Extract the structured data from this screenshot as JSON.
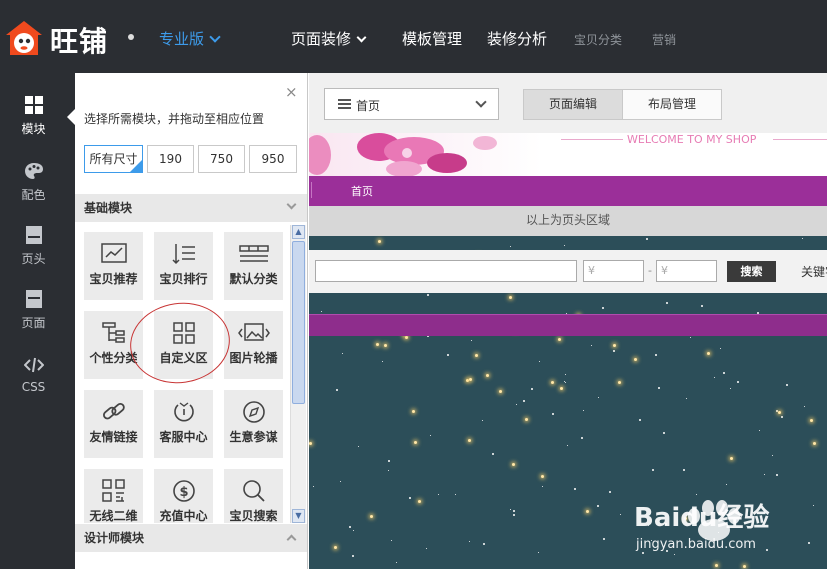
{
  "header": {
    "brand": "旺铺",
    "edition": "专业版",
    "nav": [
      {
        "label": "页面装修"
      },
      {
        "label": "模板管理"
      },
      {
        "label": "装修分析"
      },
      {
        "label": "宝贝分类"
      },
      {
        "label": "营销"
      }
    ]
  },
  "rail": {
    "items": [
      {
        "label": "模块",
        "icon": "grid-icon"
      },
      {
        "label": "配色",
        "icon": "palette-icon"
      },
      {
        "label": "页头",
        "icon": "page-header-icon"
      },
      {
        "label": "页面",
        "icon": "page-icon"
      },
      {
        "label": "CSS",
        "icon": "code-icon"
      }
    ]
  },
  "panel": {
    "close": "×",
    "tip": "选择所需模块，并拖动至相应位置",
    "sizes": [
      "所有尺寸",
      "190",
      "750",
      "950"
    ],
    "section_basic": "基础模块",
    "section_designer": "设计师模块",
    "modules": [
      {
        "label": "宝贝推荐",
        "icon": "chart-icon"
      },
      {
        "label": "宝贝排行",
        "icon": "sort-icon"
      },
      {
        "label": "默认分类",
        "icon": "category-icon"
      },
      {
        "label": "个性分类",
        "icon": "tree-icon"
      },
      {
        "label": "自定义区",
        "icon": "custom-grid-icon"
      },
      {
        "label": "图片轮播",
        "icon": "carousel-icon"
      },
      {
        "label": "友情链接",
        "icon": "link-icon"
      },
      {
        "label": "客服中心",
        "icon": "service-icon"
      },
      {
        "label": "生意参谋",
        "icon": "compass-icon"
      },
      {
        "label": "无线二维",
        "icon": "qrcode-icon"
      },
      {
        "label": "充值中心",
        "icon": "dollar-icon"
      },
      {
        "label": "宝贝搜索",
        "icon": "search-icon"
      }
    ]
  },
  "main": {
    "page_select": "首页",
    "tabs": [
      "页面编辑",
      "布局管理"
    ],
    "welcome": "WELCOME TO MY SHOP",
    "nav_home": "首页",
    "header_note": "以上为页头区域",
    "search": {
      "price_min_placeholder": "¥",
      "price_max_placeholder": "¥",
      "dash": "-",
      "button": "搜索",
      "keyword_label": "关键字"
    }
  },
  "watermark": {
    "text": "Baidu经验",
    "url": "jingyan.baidu.com"
  },
  "colors": {
    "topbar": "#2b2e33",
    "accent": "#3d9bea",
    "shop_purple": "#9b2f99",
    "annotation_red": "#c83535"
  }
}
